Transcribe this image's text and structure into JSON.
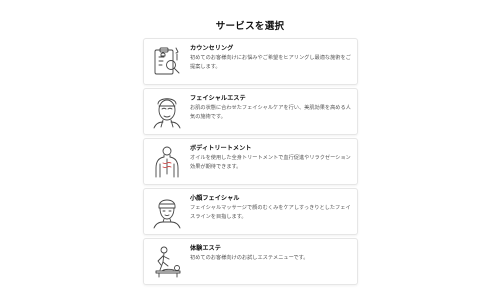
{
  "header": {
    "title": "サービスを選択"
  },
  "services": [
    {
      "name": "カウンセリング",
      "description": "初めてのお客様向けにお悩みやご希望をヒアリングし最適な施術をご提案します。",
      "icon": "consultation-clipboard-icon"
    },
    {
      "name": "フェイシャルエステ",
      "description": "お肌の状態に合わせたフェイシャルケアを行い、美肌効果を高める人気の施術です。",
      "icon": "facial-mask-icon"
    },
    {
      "name": "ボディトリートメント",
      "description": "オイルを使用した全身トリートメントで血行促進やリラクゼーション効果が期待できます。",
      "icon": "body-back-icon"
    },
    {
      "name": "小顔フェイシャル",
      "description": "フェイシャルマッサージで顔のむくみをケアしすっきりとしたフェイスラインを目指します。",
      "icon": "face-towel-icon"
    },
    {
      "name": "体験エステ",
      "description": "初めてのお客様向けのお試しエステメニューです。",
      "icon": "massage-treatment-icon"
    }
  ]
}
